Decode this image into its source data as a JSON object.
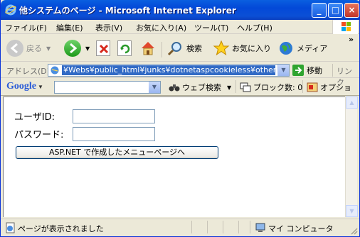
{
  "window": {
    "title": "他システムのページ - Microsoft Internet Explorer"
  },
  "menu": [
    "ファイル(F)",
    "編集(E)",
    "表示(V)",
    "お気に入り(A)",
    "ツール(T)",
    "ヘルプ(H)"
  ],
  "toolbar": {
    "back": "戻る",
    "search": "検索",
    "favorites": "お気に入り",
    "media": "メディア",
    "chevron": "»"
  },
  "address": {
    "label": "アドレス(D)",
    "url": "¥Webs¥public_html¥junks¥dotnetaspcookieless¥other.htm",
    "go": "移動",
    "links": "リンク"
  },
  "google": {
    "logo": "Google",
    "search_button": "ウェブ検索",
    "popup_block": "ブロック数: 0",
    "options": "オプショ"
  },
  "form": {
    "userid_label": "ユーザID:",
    "password_label": "パスワード:",
    "userid_value": "",
    "password_value": "",
    "submit_label": "ASP.NET で作成したメニューページへ"
  },
  "status": {
    "text": "ページが表示されました",
    "zone": "マイ コンピュータ"
  }
}
